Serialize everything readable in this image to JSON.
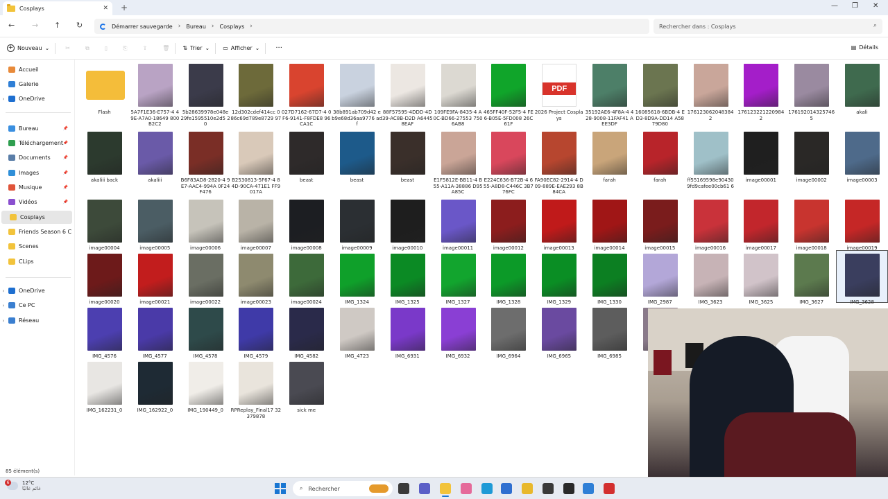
{
  "window": {
    "tab_title": "Cosplays",
    "close_glyph": "✕",
    "new_tab_glyph": "+",
    "minimize_glyph": "—",
    "maximize_glyph": "❐",
    "window_close_glyph": "✕"
  },
  "nav": {
    "back_glyph": "←",
    "forward_glyph": "→",
    "up_glyph": "↑",
    "refresh_glyph": "↻"
  },
  "address": {
    "segments": [
      "Démarrer sauvegarde",
      "Bureau",
      "Cosplays"
    ],
    "separator": "›",
    "search_placeholder": "Rechercher dans : Cosplays",
    "search_glyph": "⌕"
  },
  "toolbar": {
    "new_label": "Nouveau",
    "new_glyph": "+",
    "sort_label": "Trier",
    "sort_glyph": "⇅",
    "view_label": "Afficher",
    "view_glyph": "▭",
    "chevron_glyph": "⌄",
    "more_glyph": "···",
    "details_label": "Détails",
    "details_glyph": "▤",
    "disabled_glyphs": [
      "✂",
      "⧉",
      "▯",
      "⎘",
      "⇪",
      "🗑"
    ]
  },
  "sidebar": {
    "items": [
      {
        "label": "Accueil",
        "color": "#e88a3a",
        "chevron": false,
        "pinned": false
      },
      {
        "label": "Galerie",
        "color": "#2f7fd6",
        "chevron": false,
        "pinned": false
      },
      {
        "label": "OneDrive",
        "color": "#1e6fd0",
        "chevron": true,
        "pinned": false
      },
      {
        "label": "Bureau",
        "color": "#3a8fe0",
        "chevron": false,
        "pinned": true
      },
      {
        "label": "Téléchargement",
        "color": "#2e9e4f",
        "chevron": false,
        "pinned": true
      },
      {
        "label": "Documents",
        "color": "#5a7ea8",
        "chevron": false,
        "pinned": true
      },
      {
        "label": "Images",
        "color": "#2f8fd8",
        "chevron": false,
        "pinned": true
      },
      {
        "label": "Musique",
        "color": "#e0543a",
        "chevron": false,
        "pinned": true
      },
      {
        "label": "Vidéos",
        "color": "#8a4fcf",
        "chevron": false,
        "pinned": true
      },
      {
        "label": "Cosplays",
        "color": "#f2c33b",
        "chevron": false,
        "pinned": false,
        "selected": true
      },
      {
        "label": "Friends Season 6 C",
        "color": "#f2c33b",
        "chevron": false,
        "pinned": false
      },
      {
        "label": "Scenes",
        "color": "#f2c33b",
        "chevron": false,
        "pinned": false
      },
      {
        "label": "CLips",
        "color": "#f2c33b",
        "chevron": false,
        "pinned": false
      },
      {
        "label": "OneDrive",
        "color": "#1e6fd0",
        "chevron": true,
        "pinned": false
      },
      {
        "label": "Ce PC",
        "color": "#3a7fd0",
        "chevron": true,
        "pinned": false
      },
      {
        "label": "Réseau",
        "color": "#3a7fd0",
        "chevron": true,
        "pinned": false
      }
    ],
    "chevron_glyph": "›",
    "pin_glyph": "📌"
  },
  "files": [
    {
      "name": "Flash",
      "type": "folder"
    },
    {
      "name": "5A7F1E36-E757-4 49E-A7A0-18649 800B2C2",
      "color": "#b9a3c4"
    },
    {
      "name": "5b28639978e048e 29fe1595510e2d5 20",
      "color": "#3b3b4a"
    },
    {
      "name": "12d302cdef414cc 086c69d789e8729 97",
      "color": "#6d6a3a"
    },
    {
      "name": "027D7162-67D7-4 0F6-9141-F8FDE8 96CA1C",
      "color": "#d9442f"
    },
    {
      "name": "38b891ab709d42 eb9e68d36aa9776 adf",
      "color": "#c9d2df"
    },
    {
      "name": "88F57595-4DDD-4D39-AC8B-D2D A64458EAF",
      "color": "#ece7e2"
    },
    {
      "name": "109FE9FA-8435-4 A0C-BD66-27553 7506AB8",
      "color": "#dcd9d2"
    },
    {
      "name": "465FF40F-52F5-4 FE6-B05E-5FD008 26C61F",
      "color": "#10a52a"
    },
    {
      "name": "2026 Project Cosplays",
      "type": "pdf",
      "badge": "PDF"
    },
    {
      "name": "35192AE6-4F8A-4 428-9008-11FAF41 AEE3DF",
      "color": "#4d7f68"
    },
    {
      "name": "16085618-6BDB-4 ED3-8D9A-DD14 A5879D80",
      "color": "#6b7550"
    },
    {
      "name": "176123062048384 2",
      "color": "#c9a69a"
    },
    {
      "name": "176123221220984 2",
      "color": "#a41ec9"
    },
    {
      "name": "176192014325746 5",
      "color": "#9a8aa0"
    },
    {
      "name": "akali",
      "color": "#3f6a4e"
    },
    {
      "name": "akaliii back",
      "color": "#2c3a2e"
    },
    {
      "name": "akaliii",
      "color": "#6a5aa8"
    },
    {
      "name": "B6F83AD8-2820-4 9E7-AAC4-994A 0F24F476",
      "color": "#7a2e26"
    },
    {
      "name": "B2530813-5F67-4 84D-90CA-471E1 FF9017A",
      "color": "#d9c9b9"
    },
    {
      "name": "beast",
      "color": "#2e2a2a"
    },
    {
      "name": "beast",
      "color": "#1d5a8a"
    },
    {
      "name": "beast",
      "color": "#3a2f2a"
    },
    {
      "name": "E1F5812E-BB11-4 B55-A11A-38886 D95A85C",
      "color": "#caa597"
    },
    {
      "name": "E224C636-B72B-4 655-A8D8-C446C 3B776FC",
      "color": "#d9475c"
    },
    {
      "name": "FA90EC82-2914-4 D09-889E-EAE293 8B84CA",
      "color": "#b7462f"
    },
    {
      "name": "farah",
      "color": "#c9a57a"
    },
    {
      "name": "farah",
      "color": "#b8242a"
    },
    {
      "name": "ff55169598e90430 9fd9cafee00cb61 6",
      "color": "#9fc0c8"
    },
    {
      "name": "image00001",
      "color": "#1f1f1f"
    },
    {
      "name": "image00002",
      "color": "#2a2826"
    },
    {
      "name": "image00003",
      "color": "#4e6a8a"
    },
    {
      "name": "image00004",
      "color": "#3d4a3a"
    },
    {
      "name": "image00005",
      "color": "#4b5d64"
    },
    {
      "name": "image00006",
      "color": "#c6c3ba"
    },
    {
      "name": "image00007",
      "color": "#b9b3a7"
    },
    {
      "name": "image00008",
      "color": "#1c1e22"
    },
    {
      "name": "image00009",
      "color": "#2b2f33"
    },
    {
      "name": "image00010",
      "color": "#1e1e1e"
    },
    {
      "name": "image00011",
      "color": "#6a57c8"
    },
    {
      "name": "image00012",
      "color": "#8c1d1d"
    },
    {
      "name": "image00013",
      "color": "#c01a1a"
    },
    {
      "name": "image00014",
      "color": "#a01616"
    },
    {
      "name": "image00015",
      "color": "#7a1c1c"
    },
    {
      "name": "image00016",
      "color": "#c9323a"
    },
    {
      "name": "image00017",
      "color": "#c2262c"
    },
    {
      "name": "image00018",
      "color": "#c8342f"
    },
    {
      "name": "image00019",
      "color": "#c52726"
    },
    {
      "name": "image00020",
      "color": "#6d1a1a"
    },
    {
      "name": "image00021",
      "color": "#c21d1d"
    },
    {
      "name": "image00022",
      "color": "#6a6e63"
    },
    {
      "name": "image00023",
      "color": "#8e8a6f"
    },
    {
      "name": "image00024",
      "color": "#3d6a3a"
    },
    {
      "name": "IMG_1324",
      "color": "#0fa02a"
    },
    {
      "name": "IMG_1325",
      "color": "#0b8a24"
    },
    {
      "name": "IMG_1327",
      "color": "#12a52e"
    },
    {
      "name": "IMG_1328",
      "color": "#0c9a28"
    },
    {
      "name": "IMG_1329",
      "color": "#0a8e24"
    },
    {
      "name": "IMG_1330",
      "color": "#0c7f22"
    },
    {
      "name": "IMG_2987",
      "color": "#b3a7d8"
    },
    {
      "name": "IMG_3623",
      "color": "#c7b3b6"
    },
    {
      "name": "IMG_3625",
      "color": "#d1c3c9"
    },
    {
      "name": "IMG_3627",
      "color": "#5c7a4e"
    },
    {
      "name": "IMG_3628",
      "color": "#3a3e5e",
      "selected": true
    },
    {
      "name": "IMG_4576",
      "color": "#4c3fb0"
    },
    {
      "name": "IMG_4577",
      "color": "#4a3aa8"
    },
    {
      "name": "IMG_4578",
      "color": "#2e4a4a"
    },
    {
      "name": "IMG_4579",
      "color": "#3f3aa8"
    },
    {
      "name": "IMG_4582",
      "color": "#2a2a4a"
    },
    {
      "name": "IMG_4723",
      "color": "#cfc9c4"
    },
    {
      "name": "IMG_6931",
      "color": "#7a39c9"
    },
    {
      "name": "IMG_6932",
      "color": "#8a3fd4"
    },
    {
      "name": "IMG_6964",
      "color": "#6d6d6d"
    },
    {
      "name": "IMG_6965",
      "color": "#6a4aa0"
    },
    {
      "name": "IMG_6985",
      "color": "#5d5d5d"
    },
    {
      "name": "IMG_",
      "color": "#8a7a8a"
    },
    {
      "name": "",
      "color": "#4a4a4a"
    },
    {
      "name": "",
      "color": "#c7c0c0"
    },
    {
      "name": "",
      "color": "#3a3a3a"
    },
    {
      "name": "",
      "color": "#2a2a2a"
    },
    {
      "name": "IMG_162231_0",
      "color": "#e8e6e3"
    },
    {
      "name": "IMG_162922_0",
      "color": "#1e2a34"
    },
    {
      "name": "IMG_190449_0",
      "color": "#f0ede8"
    },
    {
      "name": "RPReplay_Final17 32379878",
      "color": "#e9e4dc"
    },
    {
      "name": "sick me",
      "color": "#4a4a52"
    }
  ],
  "status": {
    "item_count": "85 élément(s)"
  },
  "taskbar": {
    "weather_temp": "12°C",
    "weather_desc": "غائم غالبًا",
    "notification_count": "6",
    "search_placeholder": "Rechercher",
    "search_glyph": "⌕",
    "apps": [
      {
        "name": "task-view",
        "color": "#3a3a3a"
      },
      {
        "name": "teams",
        "color": "#5b5fc7"
      },
      {
        "name": "file-explorer",
        "color": "#f2c33b",
        "active": true
      },
      {
        "name": "paint",
        "color": "#e56a9a"
      },
      {
        "name": "edge",
        "color": "#1f9ad6"
      },
      {
        "name": "store",
        "color": "#2f6fd0"
      },
      {
        "name": "chrome",
        "color": "#e8b82c"
      },
      {
        "name": "obs",
        "color": "#3a3a3a"
      },
      {
        "name": "vegas",
        "color": "#2a2a2a"
      },
      {
        "name": "snipping",
        "color": "#2f7fd6"
      },
      {
        "name": "opera",
        "color": "#d32f2f"
      }
    ]
  }
}
